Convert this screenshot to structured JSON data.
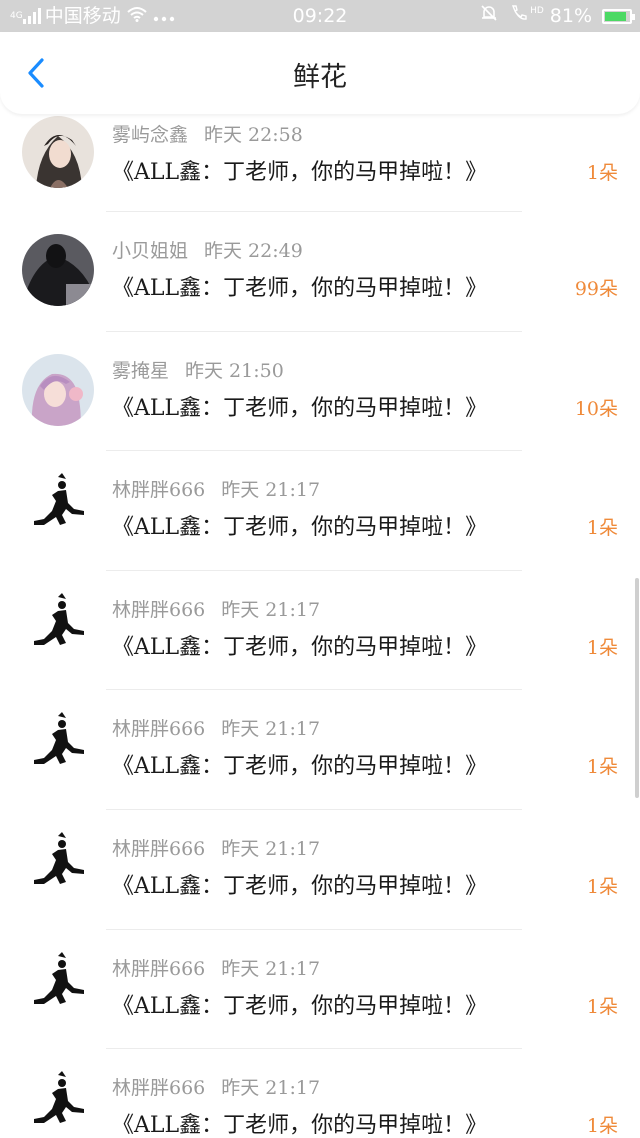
{
  "status_bar": {
    "carrier": "中国移动",
    "signal_label": "4G",
    "time": "09:22",
    "hd_label": "HD",
    "battery": "81%",
    "battery_level": 0.81
  },
  "header": {
    "title": "鲜花",
    "back_icon": "chevron-left-icon"
  },
  "items": [
    {
      "name": "雾屿念鑫",
      "time": "昨天 22:58",
      "book": "《ALL鑫：丁老师，你的马甲掉啦！》",
      "count": "1朵",
      "avatar": "photo-dark-hair"
    },
    {
      "name": "小贝姐姐",
      "time": "昨天 22:49",
      "book": "《ALL鑫：丁老师，你的马甲掉啦！》",
      "count": "99朵",
      "avatar": "photo-black-outfit"
    },
    {
      "name": "雾掩星",
      "time": "昨天 21:50",
      "book": "《ALL鑫：丁老师，你的马甲掉啦！》",
      "count": "10朵",
      "avatar": "photo-pink-girl"
    },
    {
      "name": "林胖胖666",
      "time": "昨天 21:17",
      "book": "《ALL鑫：丁老师，你的马甲掉啦！》",
      "count": "1朵",
      "avatar": "jumpman-logo"
    },
    {
      "name": "林胖胖666",
      "time": "昨天 21:17",
      "book": "《ALL鑫：丁老师，你的马甲掉啦！》",
      "count": "1朵",
      "avatar": "jumpman-logo"
    },
    {
      "name": "林胖胖666",
      "time": "昨天 21:17",
      "book": "《ALL鑫：丁老师，你的马甲掉啦！》",
      "count": "1朵",
      "avatar": "jumpman-logo"
    },
    {
      "name": "林胖胖666",
      "time": "昨天 21:17",
      "book": "《ALL鑫：丁老师，你的马甲掉啦！》",
      "count": "1朵",
      "avatar": "jumpman-logo"
    },
    {
      "name": "林胖胖666",
      "time": "昨天 21:17",
      "book": "《ALL鑫：丁老师，你的马甲掉啦！》",
      "count": "1朵",
      "avatar": "jumpman-logo"
    },
    {
      "name": "林胖胖666",
      "time": "昨天 21:17",
      "book": "《ALL鑫：丁老师，你的马甲掉啦！》",
      "count": "1朵",
      "avatar": "jumpman-logo"
    }
  ],
  "colors": {
    "accent": "#1a8cff",
    "count": "#ef8a3a",
    "meta": "#9a9a9a"
  }
}
